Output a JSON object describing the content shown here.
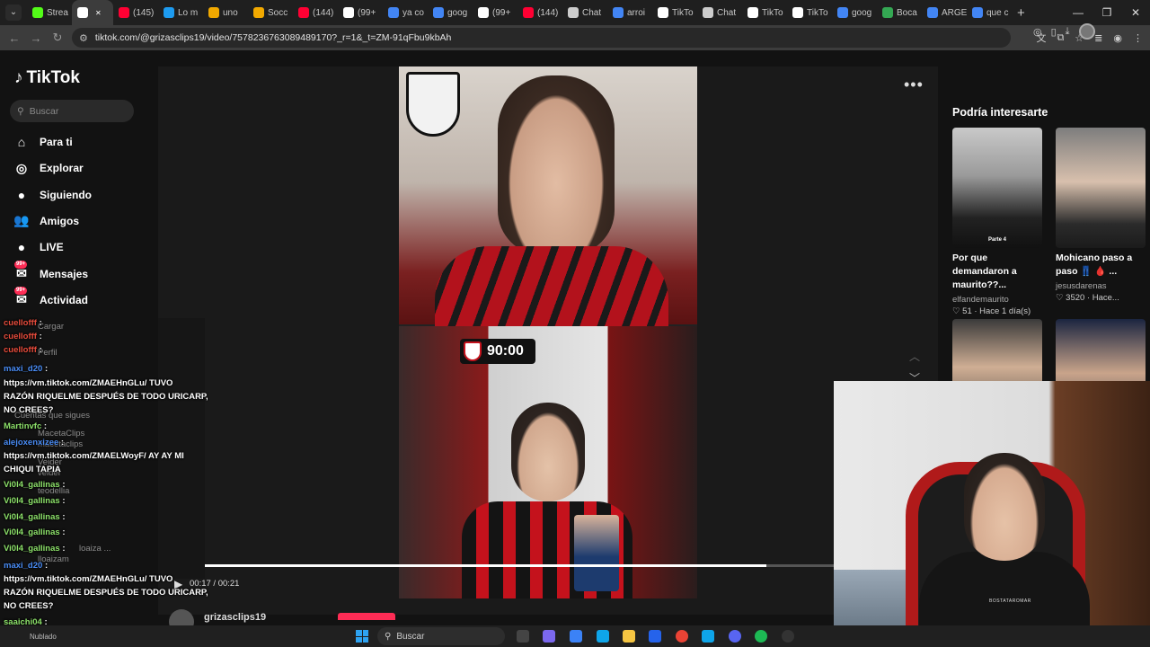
{
  "browser": {
    "tabs": [
      {
        "label": "Strea",
        "color": "#53fc18"
      },
      {
        "label": "",
        "color": "#ffffff",
        "active": true
      },
      {
        "label": "(145)",
        "color": "#ff0033"
      },
      {
        "label": "Lo m",
        "color": "#1d9bf0"
      },
      {
        "label": "uno",
        "color": "#f2a900"
      },
      {
        "label": "Socc",
        "color": "#f2a900"
      },
      {
        "label": "(144)",
        "color": "#ff0033"
      },
      {
        "label": "(99+",
        "color": "#ffffff"
      },
      {
        "label": "ya co",
        "color": "#4285f4"
      },
      {
        "label": "goog",
        "color": "#4285f4"
      },
      {
        "label": "(99+",
        "color": "#ffffff"
      },
      {
        "label": "(144)",
        "color": "#ff0033"
      },
      {
        "label": "Chat",
        "color": "#cccccc"
      },
      {
        "label": "arroi",
        "color": "#4285f4"
      },
      {
        "label": "TikTo",
        "color": "#ffffff"
      },
      {
        "label": "Chat",
        "color": "#cccccc"
      },
      {
        "label": "TikTo",
        "color": "#ffffff"
      },
      {
        "label": "TikTo",
        "color": "#ffffff"
      },
      {
        "label": "goog",
        "color": "#4285f4"
      },
      {
        "label": "Boca",
        "color": "#34a853"
      },
      {
        "label": "ARGE",
        "color": "#4285f4"
      },
      {
        "label": "que c",
        "color": "#4285f4"
      }
    ],
    "new_tab": "+",
    "url": "tiktok.com/@grizasclips19/video/7578236763089489170?_r=1&_t=ZM-91qFbu9kbAh"
  },
  "sidebar": {
    "logo": "TikTok",
    "search_placeholder": "Buscar",
    "items": [
      {
        "label": "Para ti",
        "icon": "⌂"
      },
      {
        "label": "Explorar",
        "icon": "◎"
      },
      {
        "label": "Siguiendo",
        "icon": "●"
      },
      {
        "label": "Amigos",
        "icon": "👥"
      },
      {
        "label": "LIVE",
        "icon": "●"
      },
      {
        "label": "Mensajes",
        "icon": "✉",
        "badge": "99+"
      },
      {
        "label": "Actividad",
        "icon": "✉",
        "badge": "99+"
      }
    ]
  },
  "player": {
    "timer_badge": "90:00",
    "time": "00:17 / 00:21",
    "progress": 0.9,
    "author": "grizasclips19"
  },
  "right_panel": {
    "title": "Podría interesarte",
    "cards": [
      {
        "title": "Por que demandaron a maurito??...",
        "user": "elfandemaurito",
        "meta": "♡ 51 · Hace 1 día(s)",
        "thumb_caption": "Parte 4"
      },
      {
        "title": "Mohicano paso a paso 👖 🩸 ...",
        "user": "jesusdarenas",
        "meta": "♡ 3520 · Hace..."
      },
      {
        "title": "",
        "user": "",
        "meta": ""
      },
      {
        "title": "",
        "user": "",
        "meta": ""
      }
    ]
  },
  "chat": {
    "lines": [
      {
        "user": "cuellofff",
        "msg": ":",
        "color": "red"
      },
      {
        "user": "cuellofff",
        "msg": ":",
        "color": "red"
      },
      {
        "user": "cuellofff",
        "msg": ":",
        "color": "red"
      },
      {
        "user": "maxi_d20",
        "msg": ":",
        "color": "blue"
      },
      {
        "user": "",
        "msg": "https://vm.tiktok.com/ZMAEHnGLu/ TUVO",
        "color": "white"
      },
      {
        "user": "",
        "msg": "RAZÓN RIQUELME DESPUÉS DE TODO URICARP,",
        "color": "white"
      },
      {
        "user": "",
        "msg": "NO CREES?",
        "color": "white"
      },
      {
        "user": "Martinvfc",
        "msg": ":",
        "color": "green"
      },
      {
        "user": "alejoxenxizee",
        "msg": ":",
        "color": "blue"
      },
      {
        "user": "",
        "msg": "https://vm.tiktok.com/ZMAELWoyF/ AY AY MI",
        "color": "white"
      },
      {
        "user": "",
        "msg": "CHIQUI TAPIA",
        "color": "white"
      },
      {
        "user": "Vi0l4_gallinas",
        "msg": ":",
        "color": "green"
      },
      {
        "user": "Vi0l4_gallinas",
        "msg": ":",
        "color": "green"
      },
      {
        "user": "Vi0l4_gallinas",
        "msg": ":",
        "color": "green"
      },
      {
        "user": "Vi0l4_gallinas",
        "msg": ":",
        "color": "green"
      },
      {
        "user": "Vi0l4_gallinas",
        "msg": ":",
        "color": "green"
      },
      {
        "user": "maxi_d20",
        "msg": ":",
        "color": "blue"
      },
      {
        "user": "",
        "msg": "https://vm.tiktok.com/ZMAEHnGLu/ TUVO",
        "color": "white"
      },
      {
        "user": "",
        "msg": "RAZÓN RIQUELME DESPUÉS DE TODO URICARP,",
        "color": "white"
      },
      {
        "user": "",
        "msg": "NO CREES?",
        "color": "white"
      },
      {
        "user": "saaichi04",
        "msg": ":",
        "color": "green"
      }
    ],
    "ghost": {
      "cargar": "Cargar",
      "perfil": "Perfil",
      "following_label": "Cuentas que sigues",
      "macetaclips": "MacetaClips",
      "macetaclips2": "macetaclips",
      "veider": "Veider",
      "veider2": "veider",
      "teodellia": "teodellia",
      "lloaizam": "lloaizam",
      "loaiza": "loaiza ..."
    }
  },
  "webcam": {
    "shirt_text": "BOSTATAROMAR"
  },
  "taskbar": {
    "weather": "Nublado",
    "search_placeholder": "Buscar"
  }
}
